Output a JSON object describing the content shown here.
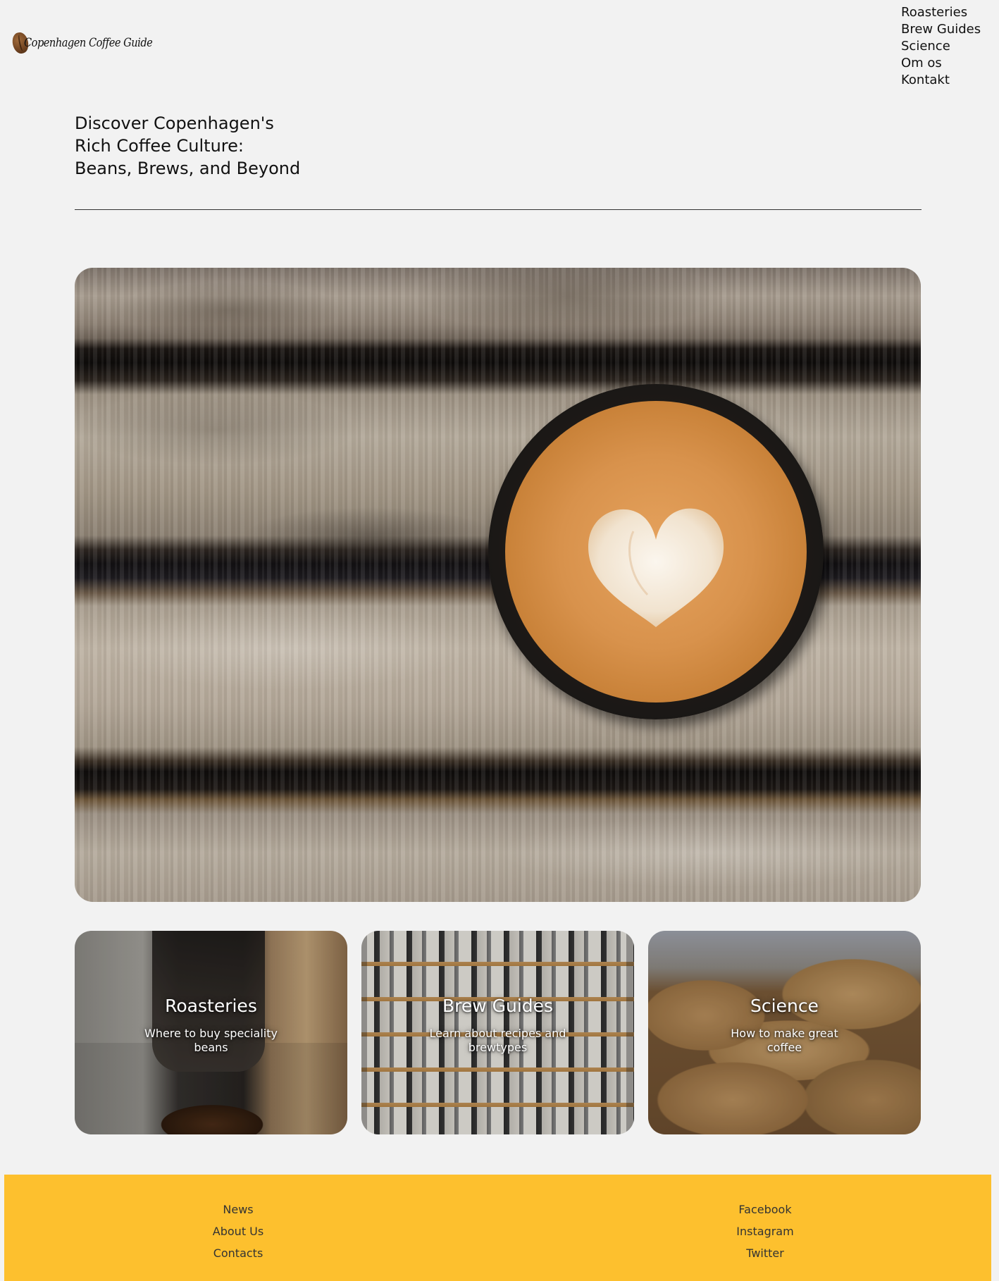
{
  "header": {
    "logo_text": "Copenhagen Coffee Guide",
    "nav": [
      {
        "label": "Roasteries"
      },
      {
        "label": "Brew Guides"
      },
      {
        "label": "Science"
      },
      {
        "label": "Om os"
      },
      {
        "label": "Kontakt"
      }
    ]
  },
  "hero": {
    "heading_lines": [
      "Discover Copenhagen's",
      "Rich Coffee Culture:",
      "Beans, Brews, and Beyond"
    ]
  },
  "cards": [
    {
      "title": "Roasteries",
      "subtitle": "Where to buy speciality beans"
    },
    {
      "title": "Brew Guides",
      "subtitle": "Learn about recipes and brewtypes"
    },
    {
      "title": "Science",
      "subtitle": "How to make great coffee"
    }
  ],
  "footer": {
    "left_links": [
      {
        "label": "News"
      },
      {
        "label": "About Us"
      },
      {
        "label": "Contacts"
      }
    ],
    "right_links": [
      {
        "label": "Facebook"
      },
      {
        "label": "Instagram"
      },
      {
        "label": "Twitter"
      }
    ]
  },
  "colors": {
    "page_background": "#f2f2f2",
    "footer_background": "#fdc02e",
    "text": "#111111"
  }
}
